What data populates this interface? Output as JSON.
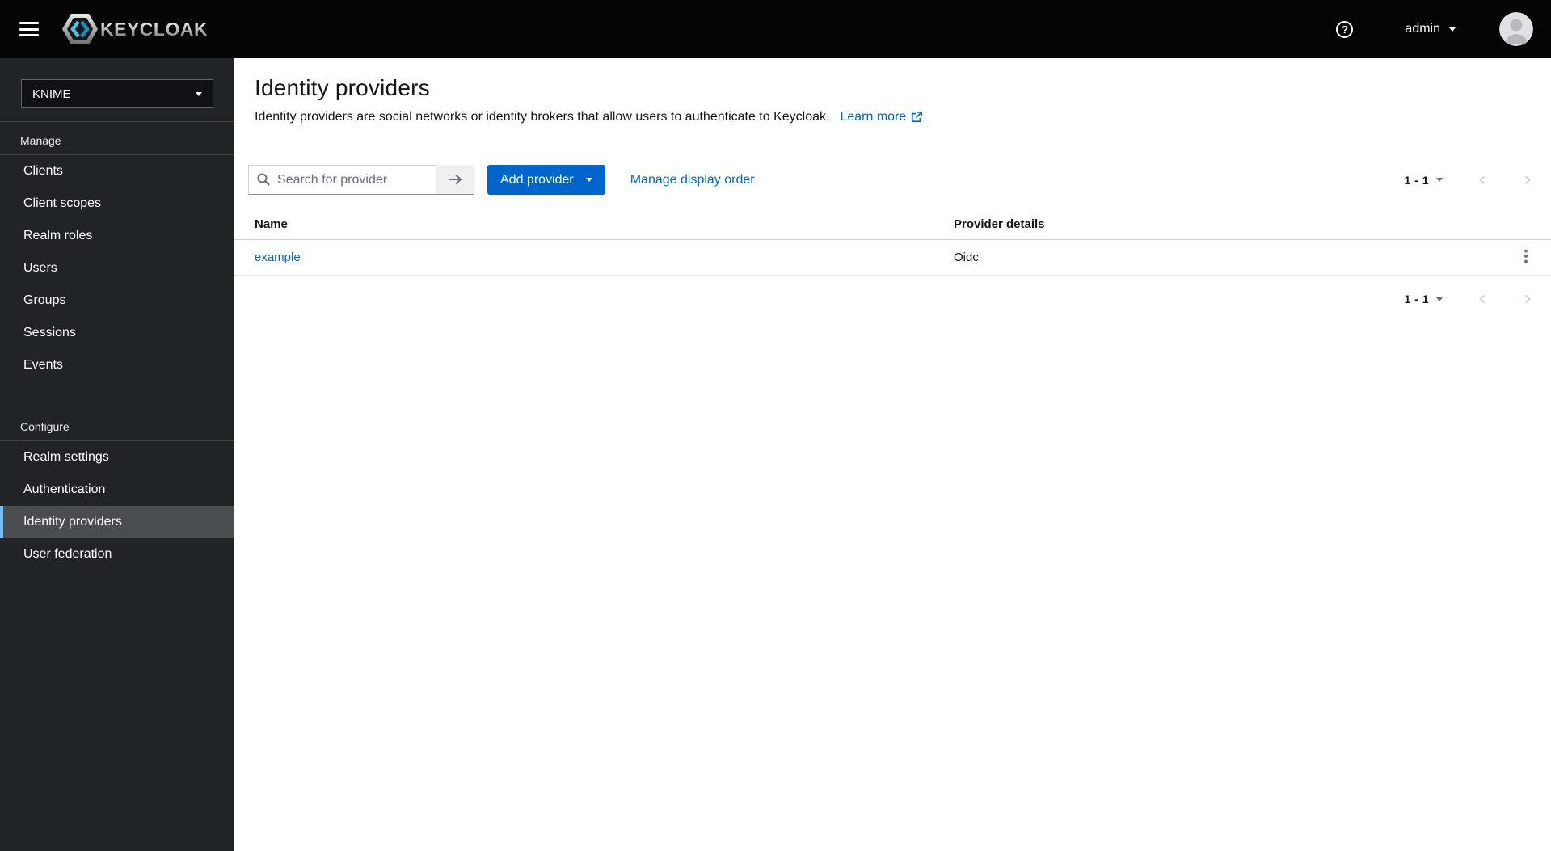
{
  "masthead": {
    "brand": "KEYCLOAK",
    "username": "admin",
    "help_glyph": "?"
  },
  "sidebar": {
    "realm_selector": {
      "value": "KNIME"
    },
    "groups": [
      {
        "label": "Manage",
        "items": [
          "Clients",
          "Client scopes",
          "Realm roles",
          "Users",
          "Groups",
          "Sessions",
          "Events"
        ]
      },
      {
        "label": "Configure",
        "items": [
          "Realm settings",
          "Authentication",
          "Identity providers",
          "User federation"
        ]
      }
    ],
    "active_item": "Identity providers"
  },
  "page": {
    "title": "Identity providers",
    "description": "Identity providers are social networks or identity brokers that allow users to authenticate to Keycloak.",
    "learn_more": "Learn more"
  },
  "toolbar": {
    "search_placeholder": "Search for provider",
    "add_provider_label": "Add provider",
    "manage_display_order_label": "Manage display order",
    "pagination": {
      "range": "1 - 1"
    }
  },
  "table": {
    "columns": [
      "Name",
      "Provider details"
    ],
    "rows": [
      {
        "name": "example",
        "provider_details": "Oidc"
      }
    ]
  },
  "colors": {
    "primary": "#0066cc",
    "masthead_bg": "#050505",
    "sidebar_bg": "#212427",
    "active_item_bg": "#4a4d50",
    "active_item_border": "#73bcf7",
    "link_blue": "#0066cc",
    "logo_cyan": "#4cc1e6"
  }
}
